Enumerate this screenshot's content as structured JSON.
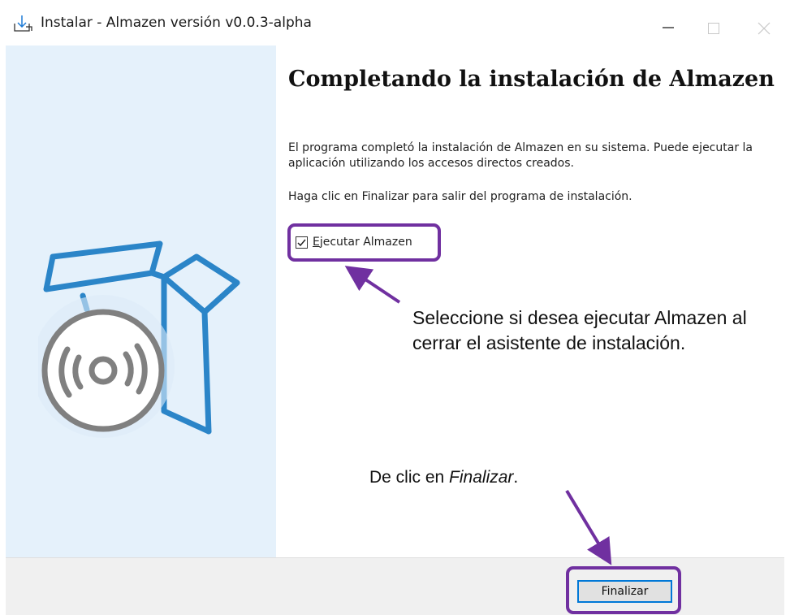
{
  "window": {
    "title": "Instalar - Almazen versión v0.0.3-alpha",
    "app_icon": "install-download-icon",
    "controls": [
      "minimize-icon",
      "maximize-icon",
      "close-icon"
    ]
  },
  "sidebar": {
    "image": "box-with-disc-illustration",
    "background": "#e5f1fb",
    "accent": "#2b85c8"
  },
  "main": {
    "heading": "Completando la instalación de Almazen",
    "paragraph1": "El programa completó la instalación de Almazen en su sistema. Puede ejecutar la aplicación utilizando los accesos directos creados.",
    "paragraph2": "Haga clic en Finalizar para salir del programa de instalación.",
    "checkbox": {
      "label": "Ejecutar Almazen",
      "checked": true
    }
  },
  "footer": {
    "finish_label": "Finalizar"
  },
  "annotations": {
    "highlight_color": "#7030a0",
    "note_run": "Seleccione si desea ejecutar Almazen al cerrar el asistente de instalación.",
    "note_finish_prefix": "De clic en ",
    "note_finish_italic": "Finalizar",
    "note_finish_suffix": "."
  }
}
